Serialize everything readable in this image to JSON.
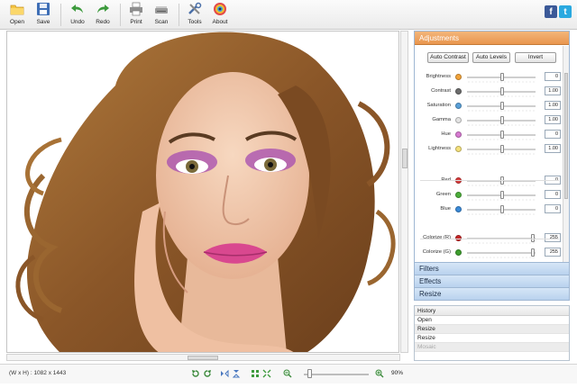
{
  "toolbar": {
    "items": [
      {
        "id": "open",
        "label": "Open",
        "icon": "folder-icon"
      },
      {
        "id": "save",
        "label": "Save",
        "icon": "floppy-icon"
      },
      {
        "id": "undo",
        "label": "Undo",
        "icon": "undo-arrow-icon"
      },
      {
        "id": "redo",
        "label": "Redo",
        "icon": "redo-arrow-icon"
      },
      {
        "id": "print",
        "label": "Print",
        "icon": "printer-icon"
      },
      {
        "id": "scan",
        "label": "Scan",
        "icon": "scanner-icon"
      },
      {
        "id": "tools",
        "label": "Tools",
        "icon": "tools-icon"
      },
      {
        "id": "about",
        "label": "About",
        "icon": "about-icon"
      }
    ],
    "social": {
      "facebook": "f",
      "twitter": "t"
    }
  },
  "canvas": {
    "image_description_icon": "portrait-photo",
    "colors": {
      "hair": "#8a5a2c",
      "skin": "#f1c9ae",
      "lips": "#d9488f",
      "shadow": "#a64bb0"
    }
  },
  "adjustments": {
    "title": "Adjustments",
    "buttons": [
      "Auto Contrast",
      "Auto Levels",
      "Invert"
    ],
    "sliders": [
      {
        "label": "Brightness",
        "value": "0",
        "icon_color": "#f2a33a",
        "pos": 0.52
      },
      {
        "label": "Contrast",
        "value": "1.00",
        "icon_color": "#6c6c6c",
        "pos": 0.52
      },
      {
        "label": "Saturation",
        "value": "1.00",
        "icon_color": "#5aa0d8",
        "pos": 0.52
      },
      {
        "label": "Gamma",
        "value": "1.00",
        "icon_color": "#e3e3e3",
        "pos": 0.52
      },
      {
        "label": "Hue",
        "value": "0",
        "icon_color": "#d77ad1",
        "pos": 0.52
      },
      {
        "label": "Lightness",
        "value": "1.00",
        "icon_color": "#f4e07a",
        "pos": 0.52
      },
      {
        "label": "Red",
        "value": "0",
        "icon_color": "#d83a3a",
        "pos": 0.52
      },
      {
        "label": "Green",
        "value": "0",
        "icon_color": "#4cae3a",
        "pos": 0.52
      },
      {
        "label": "Blue",
        "value": "0",
        "icon_color": "#3a8ad8",
        "pos": 0.52
      },
      {
        "label": "Colorize (R)",
        "value": "255",
        "icon_color": "#c62828",
        "pos": 0.98
      },
      {
        "label": "Colorize (G)",
        "value": "255",
        "icon_color": "#3e9e2e",
        "pos": 0.98
      }
    ]
  },
  "sections": [
    "Filters",
    "Effects",
    "Resize"
  ],
  "history": {
    "title": "History",
    "items": [
      {
        "label": "Open",
        "dim": false
      },
      {
        "label": "Resize",
        "dim": false
      },
      {
        "label": "Resize",
        "dim": false
      },
      {
        "label": "Mosaic",
        "dim": true
      }
    ]
  },
  "status": {
    "dimensions": "(W x H) : 1082 x 1443",
    "zoom": "90%"
  }
}
